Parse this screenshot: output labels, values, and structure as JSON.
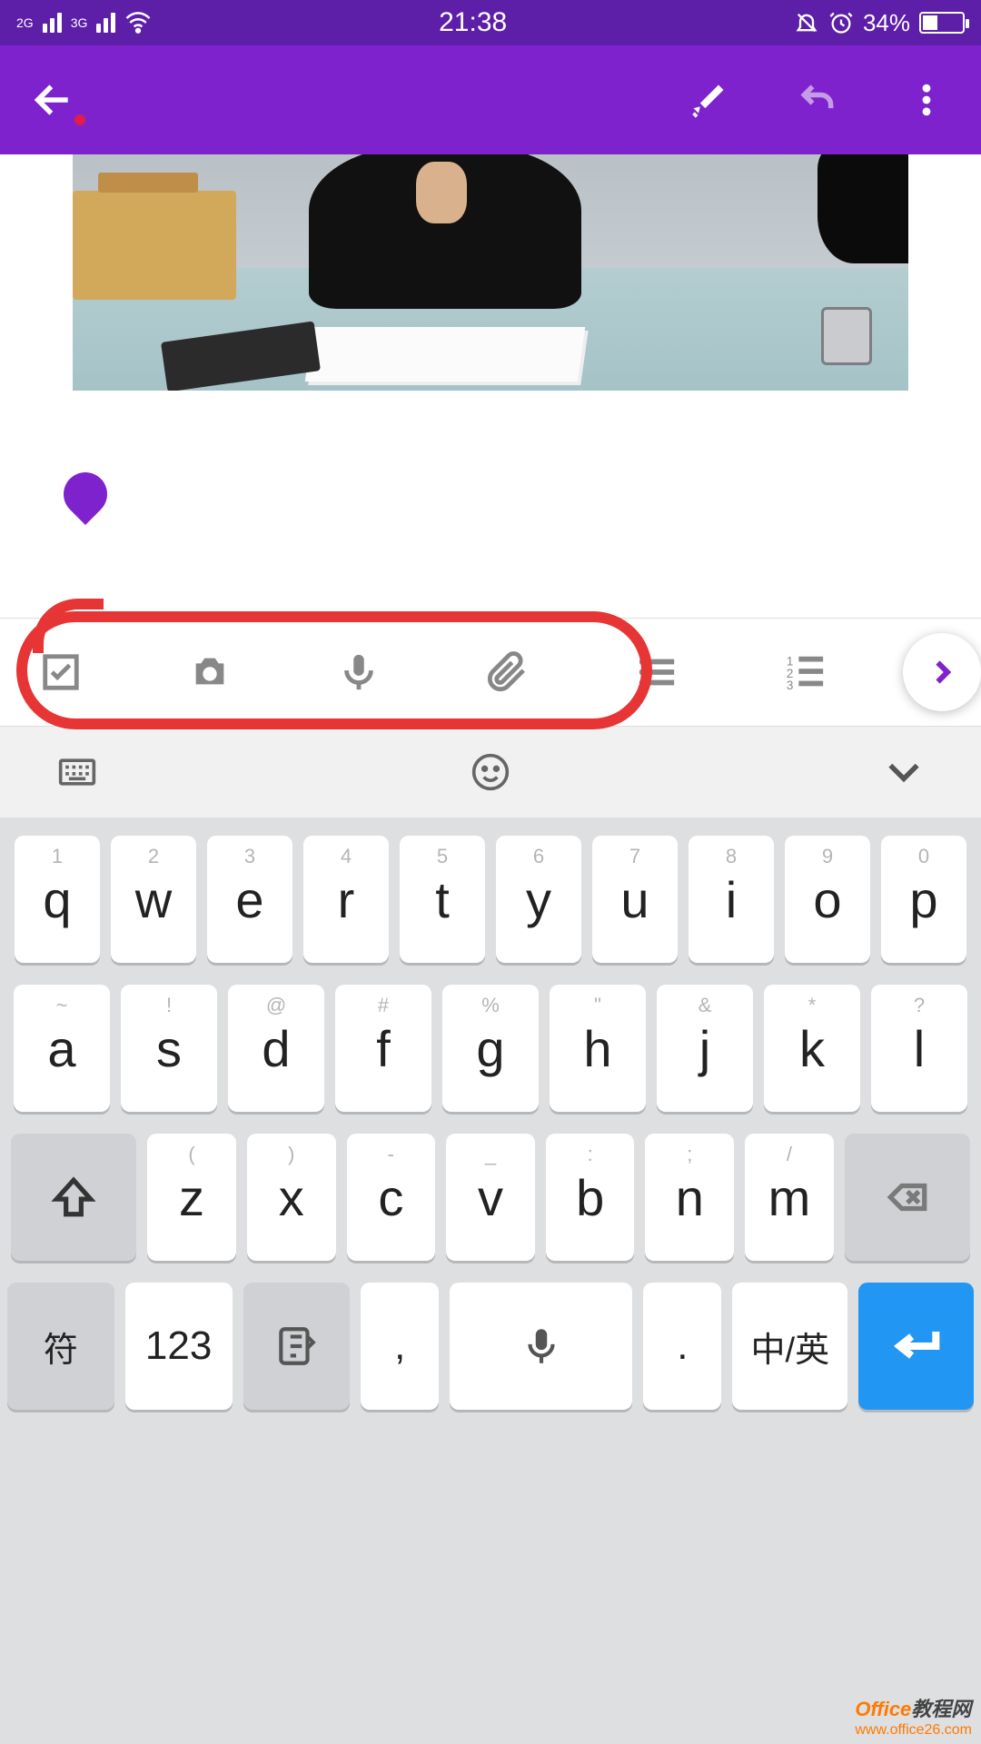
{
  "status": {
    "net1": "2G",
    "net2": "3G",
    "time": "21:38",
    "battery_text": "34%"
  },
  "toolbar": {
    "checkbox": "checkbox-icon",
    "camera": "camera-icon",
    "mic": "microphone-icon",
    "attach": "paperclip-icon",
    "bullets": "bullet-list-icon",
    "numbers": "numbered-list-icon"
  },
  "keyboard": {
    "row1": [
      {
        "sub": "1",
        "main": "q"
      },
      {
        "sub": "2",
        "main": "w"
      },
      {
        "sub": "3",
        "main": "e"
      },
      {
        "sub": "4",
        "main": "r"
      },
      {
        "sub": "5",
        "main": "t"
      },
      {
        "sub": "6",
        "main": "y"
      },
      {
        "sub": "7",
        "main": "u"
      },
      {
        "sub": "8",
        "main": "i"
      },
      {
        "sub": "9",
        "main": "o"
      },
      {
        "sub": "0",
        "main": "p"
      }
    ],
    "row2": [
      {
        "sub": "~",
        "main": "a"
      },
      {
        "sub": "!",
        "main": "s"
      },
      {
        "sub": "@",
        "main": "d"
      },
      {
        "sub": "#",
        "main": "f"
      },
      {
        "sub": "%",
        "main": "g"
      },
      {
        "sub": "\"",
        "main": "h"
      },
      {
        "sub": "&",
        "main": "j"
      },
      {
        "sub": "*",
        "main": "k"
      },
      {
        "sub": "?",
        "main": "l"
      }
    ],
    "row3": [
      {
        "sub": "(",
        "main": "z"
      },
      {
        "sub": ")",
        "main": "x"
      },
      {
        "sub": "-",
        "main": "c"
      },
      {
        "sub": "_",
        "main": "v"
      },
      {
        "sub": ":",
        "main": "b"
      },
      {
        "sub": ";",
        "main": "n"
      },
      {
        "sub": "/",
        "main": "m"
      }
    ],
    "row4": {
      "sym": "符",
      "num": "123",
      "comma": ",",
      "dot": ".",
      "cn": "中/英"
    }
  },
  "watermark": {
    "brand_a": "Office",
    "brand_b": "教程网",
    "url": "www.office26.com"
  }
}
